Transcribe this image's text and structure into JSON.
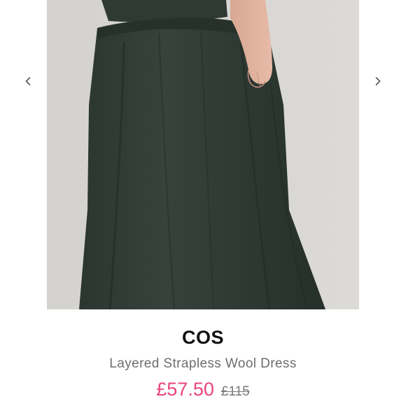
{
  "product": {
    "brand": "COS",
    "title": "Layered Strapless Wool Dress",
    "sale_price": "£57.50",
    "original_price": "£115",
    "image_alt": "Dark green wool skirt",
    "sale_color": "#e8457f"
  },
  "carousel": {
    "prev_icon": "chevron-left-icon",
    "next_icon": "chevron-right-icon"
  }
}
